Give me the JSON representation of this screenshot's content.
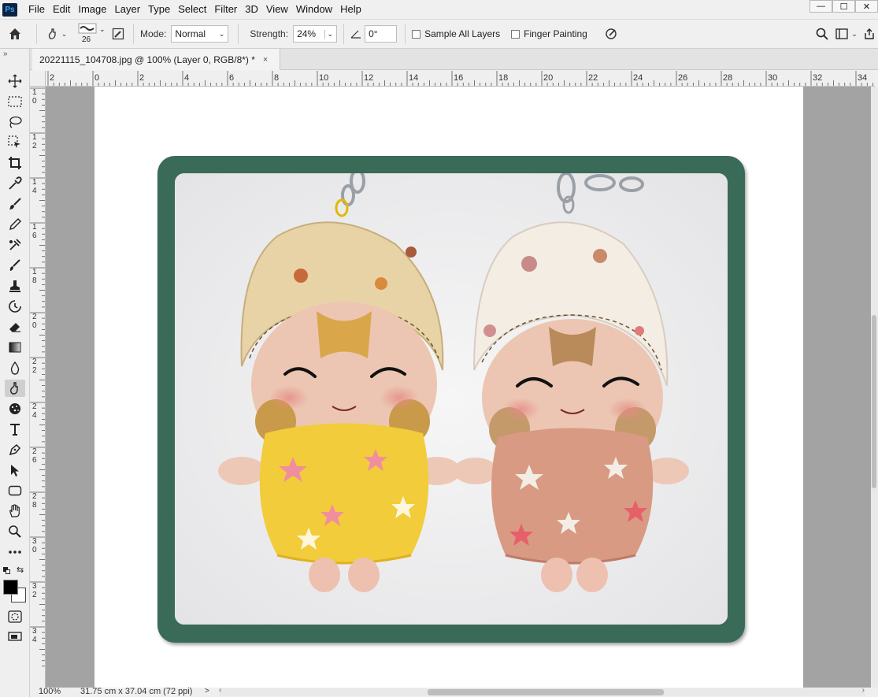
{
  "app": {
    "logo_text": "Ps"
  },
  "menu": [
    "File",
    "Edit",
    "Image",
    "Layer",
    "Type",
    "Select",
    "Filter",
    "3D",
    "View",
    "Window",
    "Help"
  ],
  "window_controls": {
    "minimize": "—",
    "maximize": "☐",
    "close": "✕"
  },
  "options_bar": {
    "brush_size": "26",
    "mode_label": "Mode:",
    "mode_value": "Normal",
    "strength_label": "Strength:",
    "strength_value": "24%",
    "angle_value": "0°",
    "sample_all_layers_label": "Sample All Layers",
    "sample_all_layers_checked": false,
    "finger_painting_label": "Finger Painting",
    "finger_painting_checked": false
  },
  "document_tab": {
    "title": "20221115_104708.jpg @ 100% (Layer 0, RGB/8*) *",
    "close": "×"
  },
  "ruler_horizontal": [
    "2",
    "0",
    "2",
    "4",
    "6",
    "8",
    "10",
    "12",
    "14",
    "16",
    "18",
    "20",
    "22",
    "24",
    "26",
    "28",
    "30",
    "32",
    "34"
  ],
  "ruler_vertical": [
    "10",
    "12",
    "14",
    "16",
    "18",
    "20",
    "22",
    "24",
    "26",
    "28",
    "30",
    "32",
    "34"
  ],
  "tools": [
    "move-tool",
    "marquee-tool",
    "lasso-tool",
    "object-select-tool",
    "crop-tool",
    "eyedropper-tool",
    "healing-brush-tool",
    "brush-tool",
    "clone-stamp-tool",
    "history-brush-tool",
    "stamp-tool",
    "art-history-tool",
    "eraser-tool",
    "gradient-tool",
    "blur-tool",
    "smudge-tool",
    "sponge-tool",
    "type-tool",
    "pen-tool",
    "path-select-tool",
    "shape-tool",
    "hand-tool",
    "zoom-tool",
    "more-tools"
  ],
  "colors": {
    "foreground": "#000000",
    "background": "#ffffff",
    "frame": "#3a6a58"
  },
  "status": {
    "zoom": "100%",
    "doc_size": "31.75 cm x 37.04 cm (72 ppi)",
    "arrow": ">"
  }
}
